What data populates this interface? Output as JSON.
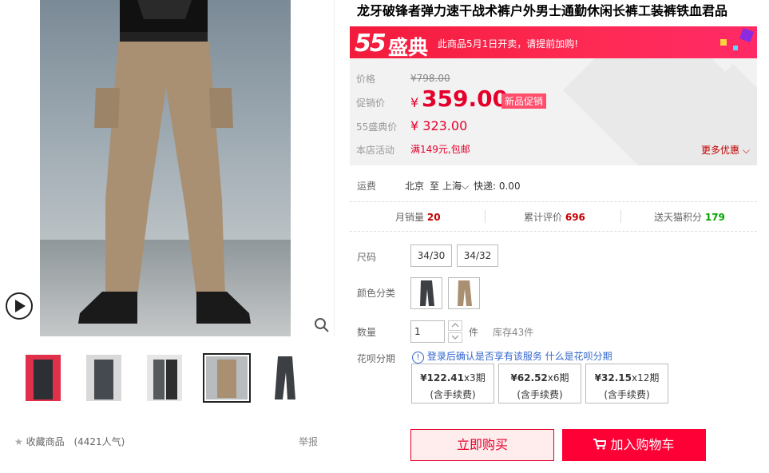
{
  "product": {
    "title": "龙牙破锋者弹力速干战术裤户外男士通勤休闲长裤工装裤铁血君品"
  },
  "banner": {
    "logo": "55",
    "logo_text": "盛典",
    "message": "此商品5月1日开卖，请提前加购!"
  },
  "prices": {
    "price_label": "价格",
    "price_value": "¥798.00",
    "promo_label": "促销价",
    "promo_currency": "¥",
    "promo_value": "359.00",
    "promo_tag": "新品促销",
    "event_label": "55盛典价",
    "event_value": "¥ 323.00",
    "activity_label": "本店活动",
    "activity_value": "满149元,包邮",
    "more_label": "更多优惠"
  },
  "shipping": {
    "label": "运费",
    "from": "北京",
    "to_word": "至",
    "to": "上海",
    "method": "快递: 0.00"
  },
  "stats": {
    "monthly_label": "月销量",
    "monthly_value": "20",
    "reviews_label": "累计评价",
    "reviews_value": "696",
    "points_label": "送天猫积分",
    "points_value": "179"
  },
  "sku": {
    "size_label": "尺码",
    "sizes": [
      "34/30",
      "34/32"
    ],
    "color_label": "颜色分类",
    "qty_label": "数量",
    "qty_value": "1",
    "qty_unit": "件",
    "stock": "库存43件"
  },
  "huabei": {
    "label": "花呗分期",
    "info": "登录后确认是否享有该服务",
    "link": "什么是花呗分期",
    "plans": [
      {
        "amount": "¥122.41",
        "periods": "x3期",
        "fee": "(含手续费)"
      },
      {
        "amount": "¥62.52",
        "periods": "x6期",
        "fee": "(含手续费)"
      },
      {
        "amount": "¥32.15",
        "periods": "x12期",
        "fee": "(含手续费)"
      }
    ]
  },
  "actions": {
    "buy_now": "立即购买",
    "add_cart": "加入购物车"
  },
  "gallery": {
    "favorite": "收藏商品",
    "popularity": "(4421人气)",
    "report": "举报",
    "selected_thumb": 3
  },
  "colors": {
    "accent": "#e4002b",
    "banner": "#ff2a54",
    "cart": "#ff0036"
  }
}
